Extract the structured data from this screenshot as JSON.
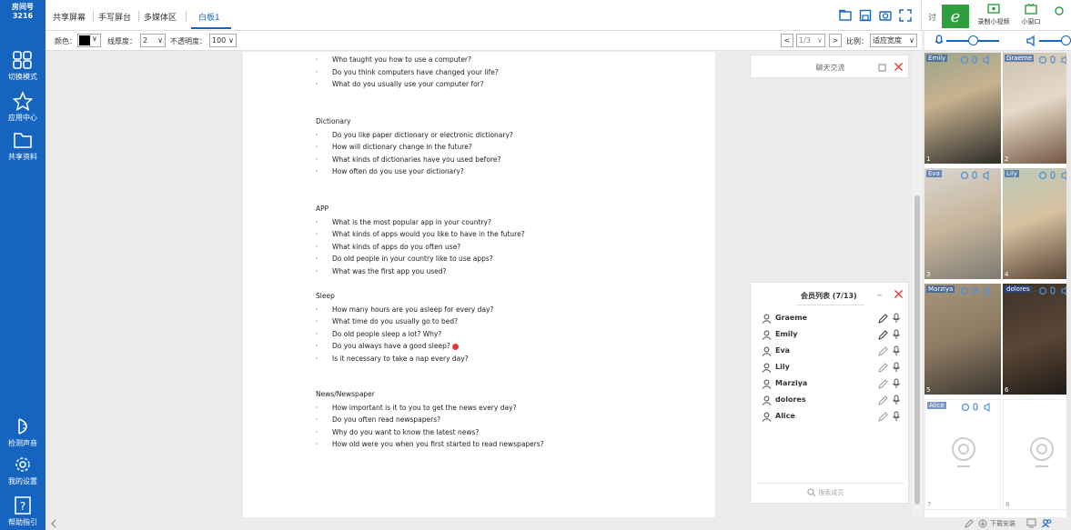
{
  "sidebar": {
    "room_label": "房间号",
    "room_number": "3216",
    "items": [
      {
        "label": "切换模式",
        "icon": "grid-icon"
      },
      {
        "label": "应用中心",
        "icon": "star-icon"
      },
      {
        "label": "共享资料",
        "icon": "folder-icon"
      },
      {
        "label": "检测声音",
        "icon": "sound-check-icon"
      },
      {
        "label": "我的设置",
        "icon": "gear-icon"
      },
      {
        "label": "帮助指引",
        "icon": "help-icon"
      }
    ]
  },
  "tabs": [
    {
      "label": "共享屏幕"
    },
    {
      "label": "手写屏台"
    },
    {
      "label": "多媒体区"
    },
    {
      "label": "白板1",
      "active": true
    }
  ],
  "right_controls": {
    "record_label": "录制小视频",
    "mini_label": "小窗口",
    "partial_label": "讨"
  },
  "toolbar": {
    "color_label": "颜色：",
    "thickness_label": "线厚度：",
    "thickness_value": "2",
    "opacity_label": "不透明度：",
    "opacity_value": "100",
    "page_value": "1/3",
    "ratio_label": "比例：",
    "ratio_value": "适应宽度"
  },
  "board": {
    "sections": [
      {
        "title": "",
        "questions": [
          "Who taught you how to use a computer?",
          "Do you think computers have changed your life?",
          "What do you usually use your computer for?"
        ]
      },
      {
        "title": "Dictionary",
        "questions": [
          "Do you like paper dictionary or electronic dictionary?",
          "How will dictionary change in the future?",
          "What kinds of dictionaries have you used before?",
          "How often do you use your dictionary?"
        ]
      },
      {
        "title": "APP",
        "questions": [
          "What is the most popular app in your country?",
          "What kinds of apps would you like to have in the future?",
          "What kinds of apps do you often use?",
          "Do old people in your country like to use apps?",
          "What was the first app you used?"
        ]
      },
      {
        "title": "Sleep",
        "questions": [
          "How many hours are you asleep for every day?",
          "What time do you usually go to bed?",
          "Do old people sleep a lot? Why?",
          "Do you always have a good sleep?",
          "Is it necessary to take a nap every day?"
        ]
      },
      {
        "title": "News/Newspaper",
        "questions": [
          "How important is it to you to get the news every day?",
          "Do you often read newspapers?",
          "Why do you want to know the latest news?",
          "How old were you when you first started to read newspapers?"
        ]
      }
    ]
  },
  "chat": {
    "title": "聊天交流"
  },
  "members": {
    "title": "会员列表 (7/13)",
    "search_placeholder": "搜索成员",
    "list": [
      "Graeme",
      "Emily",
      "Eva",
      "Lily",
      "Marziya",
      "dolores",
      "Alice"
    ]
  },
  "videos": {
    "tiles": [
      {
        "name": "Emily",
        "num": "1"
      },
      {
        "name": "Graeme",
        "num": "2"
      },
      {
        "name": "Eva",
        "num": "3"
      },
      {
        "name": "Lily",
        "num": "4"
      },
      {
        "name": "Marziya",
        "num": "5"
      },
      {
        "name": "dolores",
        "num": "6"
      },
      {
        "name": "Alice",
        "num": "7"
      },
      {
        "name": "",
        "num": "8"
      }
    ]
  },
  "status": {
    "download_label": "下载安装"
  },
  "colors": {
    "primary": "#1565c0",
    "close_red": "#e53935",
    "record_green": "#2e9e3e"
  }
}
